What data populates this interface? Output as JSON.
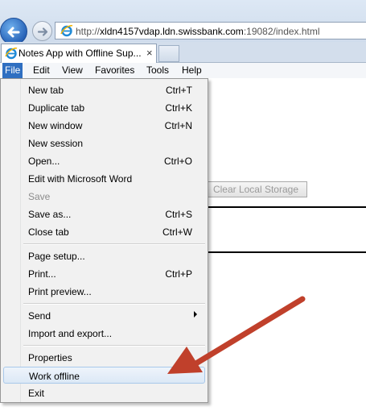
{
  "browser": {
    "address": {
      "prefix": "http://",
      "host": "xldn4157vdap.ldn.swissbank.com",
      "rest": ":19082/index.html"
    },
    "tab": {
      "title": "Notes App with Offline Sup...",
      "close": "×"
    },
    "menubar": [
      "File",
      "Edit",
      "View",
      "Favorites",
      "Tools",
      "Help"
    ]
  },
  "page": {
    "clear_button": "Clear Local Storage"
  },
  "file_menu": {
    "groups": [
      [
        {
          "label": "New tab",
          "shortcut": "Ctrl+T"
        },
        {
          "label": "Duplicate tab",
          "shortcut": "Ctrl+K"
        },
        {
          "label": "New window",
          "shortcut": "Ctrl+N"
        },
        {
          "label": "New session",
          "shortcut": ""
        },
        {
          "label": "Open...",
          "shortcut": "Ctrl+O"
        },
        {
          "label": "Edit with Microsoft Word",
          "shortcut": ""
        },
        {
          "label": "Save",
          "shortcut": "",
          "disabled": true
        },
        {
          "label": "Save as...",
          "shortcut": "Ctrl+S"
        },
        {
          "label": "Close tab",
          "shortcut": "Ctrl+W"
        }
      ],
      [
        {
          "label": "Page setup...",
          "shortcut": ""
        },
        {
          "label": "Print...",
          "shortcut": "Ctrl+P"
        },
        {
          "label": "Print preview...",
          "shortcut": ""
        }
      ],
      [
        {
          "label": "Send",
          "shortcut": "",
          "submenu": true
        },
        {
          "label": "Import and export...",
          "shortcut": ""
        }
      ],
      [
        {
          "label": "Properties",
          "shortcut": ""
        },
        {
          "label": "Work offline",
          "shortcut": "",
          "highlighted": true
        },
        {
          "label": "Exit",
          "shortcut": ""
        }
      ]
    ]
  },
  "colors": {
    "menu_active": "#2f6fc1",
    "arrow": "#c0402b"
  }
}
